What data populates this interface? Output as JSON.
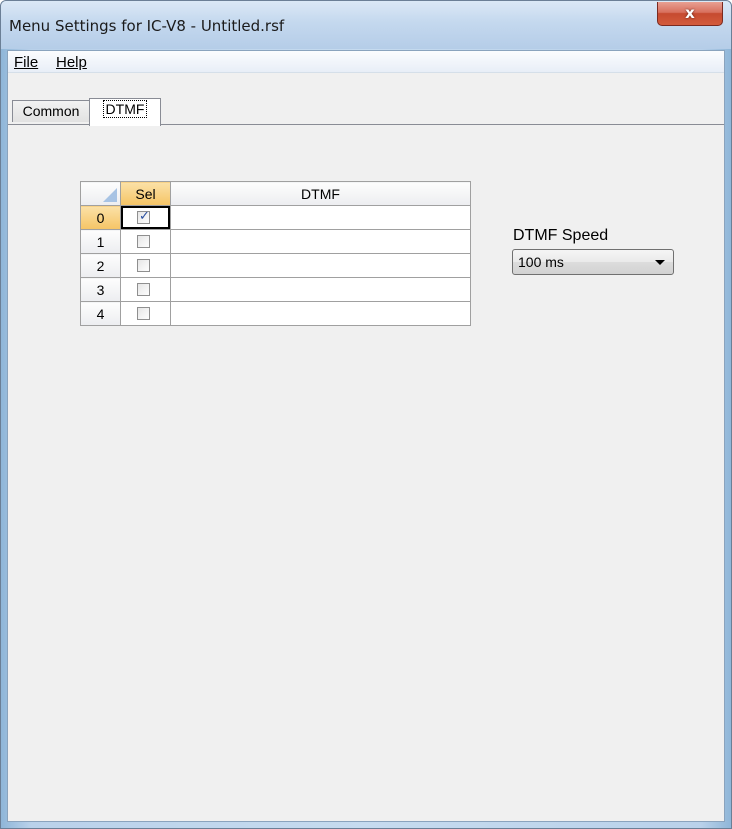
{
  "window": {
    "title": "Menu Settings for IC-V8 - Untitled.rsf",
    "close_label": "x"
  },
  "menu": {
    "items": [
      {
        "label": "File"
      },
      {
        "label": "Help"
      }
    ]
  },
  "tabs": [
    {
      "label": "Common",
      "active": false
    },
    {
      "label": "DTMF",
      "active": true
    }
  ],
  "grid": {
    "columns": [
      "Sel",
      "DTMF"
    ],
    "rows": [
      {
        "index": "0",
        "selected": true,
        "dtmf": ""
      },
      {
        "index": "1",
        "selected": false,
        "dtmf": ""
      },
      {
        "index": "2",
        "selected": false,
        "dtmf": ""
      },
      {
        "index": "3",
        "selected": false,
        "dtmf": ""
      },
      {
        "index": "4",
        "selected": false,
        "dtmf": ""
      }
    ]
  },
  "dtmf_speed": {
    "label": "DTMF Speed",
    "value": "100 ms"
  },
  "colors": {
    "header_highlight": "#f5c465",
    "close_button": "#c64a30",
    "check_mark": "#2a4fa0"
  },
  "icons": {
    "close": "close-icon",
    "dropdown": "chevron-down-icon",
    "check": "checkmark-icon"
  }
}
